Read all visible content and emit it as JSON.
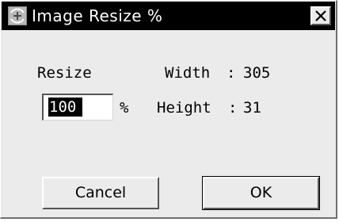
{
  "window": {
    "title": "Image Resize %"
  },
  "form": {
    "resize_label": "Resize",
    "width_label": "Width",
    "width_separator": ":",
    "width_value": "305",
    "height_label": "Height",
    "height_separator": ":",
    "height_value": "31",
    "percent_input_value": "100",
    "percent_symbol": "%"
  },
  "buttons": {
    "cancel_label": "Cancel",
    "ok_label": "OK"
  },
  "colors": {
    "title_bar": "#000000",
    "title_text": "#ffffff",
    "dialog_background": "#ebebeb",
    "selection_highlight": "#000000"
  },
  "icons": {
    "app_icon": "image-resize-icon",
    "close_icon": "close-icon"
  }
}
